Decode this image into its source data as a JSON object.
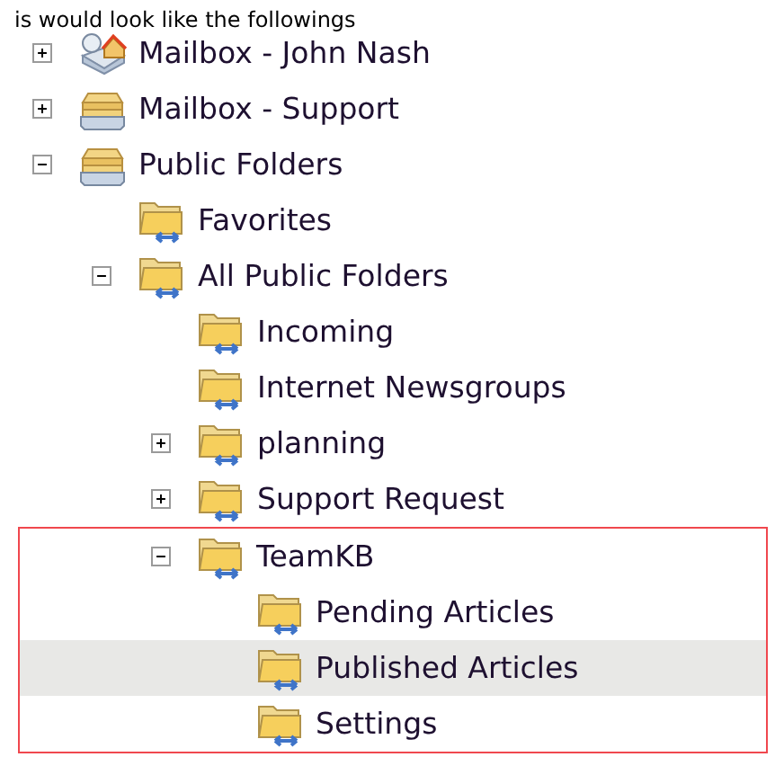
{
  "caption": "is would look like the followings",
  "tree": [
    {
      "label": "Mailbox - John Nash",
      "kind": "mailbox",
      "expanded": false,
      "selected": false
    },
    {
      "label": "Mailbox - Support",
      "kind": "store",
      "expanded": false,
      "selected": false
    },
    {
      "label": "Public Folders",
      "kind": "store",
      "expanded": true,
      "selected": false,
      "children": [
        {
          "label": "Favorites",
          "kind": "folder",
          "selected": false
        },
        {
          "label": "All Public Folders",
          "kind": "folder",
          "expanded": true,
          "selected": false,
          "children": [
            {
              "label": "Incoming",
              "kind": "folder",
              "selected": false
            },
            {
              "label": "Internet Newsgroups",
              "kind": "folder",
              "selected": false
            },
            {
              "label": "planning",
              "kind": "folder",
              "expanded": false,
              "selected": false
            },
            {
              "label": "Support Request",
              "kind": "folder",
              "expanded": false,
              "selected": false
            },
            {
              "label": "TeamKB",
              "kind": "folder",
              "expanded": true,
              "selected": false,
              "highlighted": true,
              "children": [
                {
                  "label": "Pending Articles",
                  "kind": "folder",
                  "selected": false
                },
                {
                  "label": "Published Articles",
                  "kind": "folder",
                  "selected": true
                },
                {
                  "label": "Settings",
                  "kind": "folder",
                  "selected": false
                }
              ]
            }
          ]
        }
      ]
    }
  ]
}
